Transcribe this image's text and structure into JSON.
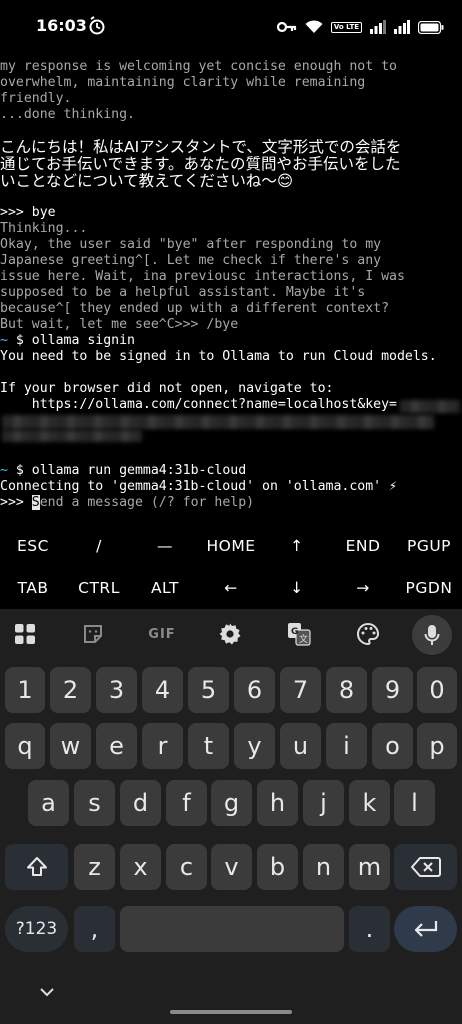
{
  "status_bar": {
    "time": "16:03",
    "left_icon": "alarm-icon",
    "right_icons": [
      "key-icon",
      "wifi-icon",
      "volte-icon",
      "signal-icon",
      "signal-icon",
      "battery-icon"
    ],
    "volte_label": "Vo LTE"
  },
  "terminal": {
    "colors": {
      "text": "#ffffff",
      "thinking": "#a8a8a8",
      "prompt_tilde": "#46c0ea",
      "background": "#000000"
    },
    "lines": {
      "l1": "my response is welcoming yet concise enough not to",
      "l2": "overwhelm, maintaining clarity while remaining",
      "l3": "friendly.",
      "l4": "...done thinking.",
      "l5": "こんにちは！私はAIアシスタントで、文字形式での会話を",
      "l6": "通じてお手伝いできます。あなたの質問やお手伝いをした",
      "l7": "いことなどについて教えてくださいね〜😊",
      "l8": ">>> bye",
      "l9": "Thinking...",
      "l10": "Okay, the user said \"bye\" after responding to my",
      "l11": "Japanese greeting^[. Let me check if there's any",
      "l12": "issue here. Wait, ina previousc interactions, I was",
      "l13": "supposed to be a helpful assistant. Maybe it's",
      "l14": "because^[ they ended up with a different context?",
      "l15": "But wait, let me see^C>>> /bye",
      "l16_tilde": "~",
      "l16": " $ ollama signin",
      "l17": "You need to be signed in to Ollama to run Cloud models.",
      "l18": "If your browser did not open, navigate to:",
      "l19": "    https://ollama.com/connect?name=localhost&key=",
      "l20_tilde": "~",
      "l20": " $ ollama run gemma4:31b-cloud",
      "l21": "Connecting to 'gemma4:31b-cloud' on 'ollama.com' ⚡",
      "l22_prompt": ">>> ",
      "l22_cursor": "S",
      "l22_placeholder": "end a message (/? for help)"
    }
  },
  "extra_keys": {
    "row1": [
      "ESC",
      "/",
      "—",
      "HOME",
      "↑",
      "END",
      "PGUP"
    ],
    "row2": [
      "TAB",
      "CTRL",
      "ALT",
      "←",
      "↓",
      "→",
      "PGDN"
    ]
  },
  "keyboard": {
    "toolbar": [
      "apps-grid-icon",
      "sticker-icon",
      "gif-icon",
      "settings-gear-icon",
      "translate-icon",
      "palette-icon",
      "microphone-icon"
    ],
    "gif_label": "GIF",
    "row_numbers": [
      "1",
      "2",
      "3",
      "4",
      "5",
      "6",
      "7",
      "8",
      "9",
      "0"
    ],
    "row_q": [
      "q",
      "w",
      "e",
      "r",
      "t",
      "y",
      "u",
      "i",
      "o",
      "p"
    ],
    "row_a": [
      "a",
      "s",
      "d",
      "f",
      "g",
      "h",
      "j",
      "k",
      "l"
    ],
    "row_z": [
      "z",
      "x",
      "c",
      "v",
      "b",
      "n",
      "m"
    ],
    "symbols_label": "?123",
    "comma": ",",
    "period": "."
  }
}
